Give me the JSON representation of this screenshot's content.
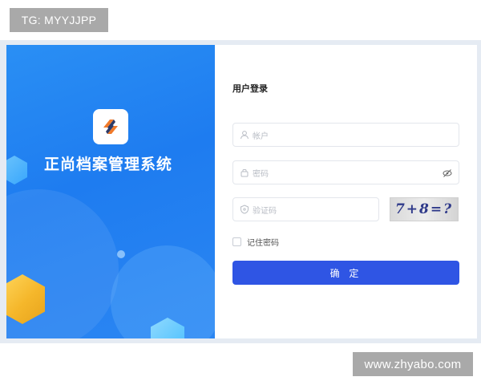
{
  "watermarks": {
    "top": "TG: MYYJJPP",
    "bottom": "www.zhyabo.com"
  },
  "brand": {
    "app_title": "正尚档案管理系统",
    "logo_icon": "brand-logo-icon",
    "colors": {
      "panel_blue": "#1e7cf0",
      "button_blue": "#2f55e4",
      "logo_orange": "#f07a2a",
      "logo_navy": "#2b3a67"
    }
  },
  "login": {
    "title": "用户登录",
    "account": {
      "placeholder": "帐户",
      "icon": "user-icon"
    },
    "password": {
      "placeholder": "密码",
      "icon": "lock-icon",
      "toggle_icon": "eye-off-icon"
    },
    "captcha": {
      "placeholder": "验证码",
      "icon": "shield-icon",
      "image_text": "7+8=?"
    },
    "remember_label": "记住密码",
    "submit_label": "确 定"
  }
}
